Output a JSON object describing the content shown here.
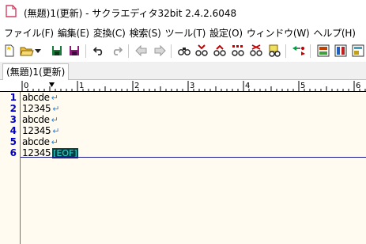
{
  "window": {
    "title": "(無題)1(更新) - サクラエディタ32bit 2.4.2.6048"
  },
  "menu": [
    {
      "label": "ファイル(F)"
    },
    {
      "label": "編集(E)"
    },
    {
      "label": "変換(C)"
    },
    {
      "label": "検索(S)"
    },
    {
      "label": "ツール(T)"
    },
    {
      "label": "設定(O)"
    },
    {
      "label": "ウィンドウ(W)"
    },
    {
      "label": "ヘルプ(H)"
    }
  ],
  "tabs": [
    {
      "label": "(無題)1(更新)"
    }
  ],
  "ruler": {
    "ticks": [
      "0",
      "1",
      "2",
      "3",
      "4",
      "5",
      "6"
    ]
  },
  "editor": {
    "lines": [
      {
        "number": "1",
        "text": "abcde",
        "ending": "↵"
      },
      {
        "number": "2",
        "text": "12345",
        "ending": "↵"
      },
      {
        "number": "3",
        "text": "abcde",
        "ending": "↵"
      },
      {
        "number": "4",
        "text": "12345",
        "ending": "↵"
      },
      {
        "number": "5",
        "text": "abcde",
        "ending": "↵"
      },
      {
        "number": "6",
        "text": "12345",
        "ending": ""
      }
    ],
    "eof_marker": "[EOF]"
  },
  "colors": {
    "line_number": "#0000c0",
    "line_ending": "#2f86d6",
    "eof_bg": "#004040",
    "eof_fg": "#30e0e0",
    "editor_bg": "#fffbf0"
  }
}
